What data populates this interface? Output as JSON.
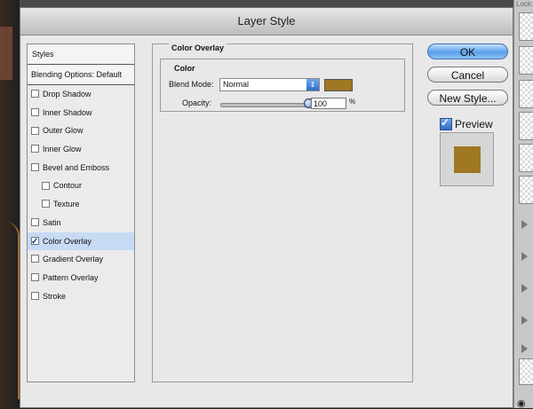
{
  "window": {
    "title": "Layer Style"
  },
  "sidebar": {
    "header": "Styles",
    "blending_options": "Blending Options: Default",
    "items": [
      {
        "label": "Drop Shadow",
        "checked": false,
        "sub": false,
        "selected": false
      },
      {
        "label": "Inner Shadow",
        "checked": false,
        "sub": false,
        "selected": false
      },
      {
        "label": "Outer Glow",
        "checked": false,
        "sub": false,
        "selected": false
      },
      {
        "label": "Inner Glow",
        "checked": false,
        "sub": false,
        "selected": false
      },
      {
        "label": "Bevel and Emboss",
        "checked": false,
        "sub": false,
        "selected": false
      },
      {
        "label": "Contour",
        "checked": false,
        "sub": true,
        "selected": false
      },
      {
        "label": "Texture",
        "checked": false,
        "sub": true,
        "selected": false
      },
      {
        "label": "Satin",
        "checked": false,
        "sub": false,
        "selected": false
      },
      {
        "label": "Color Overlay",
        "checked": true,
        "sub": false,
        "selected": true
      },
      {
        "label": "Gradient Overlay",
        "checked": false,
        "sub": false,
        "selected": false
      },
      {
        "label": "Pattern Overlay",
        "checked": false,
        "sub": false,
        "selected": false
      },
      {
        "label": "Stroke",
        "checked": false,
        "sub": false,
        "selected": false
      }
    ]
  },
  "color_overlay": {
    "group_title": "Color Overlay",
    "color_group_title": "Color",
    "blend_mode_label": "Blend Mode:",
    "blend_mode_value": "Normal",
    "overlay_color": "#A07823",
    "opacity_label": "Opacity:",
    "opacity_value": "100",
    "opacity_unit": "%",
    "opacity_level": 1.0
  },
  "buttons": {
    "ok": "OK",
    "cancel": "Cancel",
    "new_style": "New Style..."
  },
  "preview": {
    "label": "Preview",
    "checked": true
  },
  "background": {
    "lock_label": "Lock:"
  }
}
